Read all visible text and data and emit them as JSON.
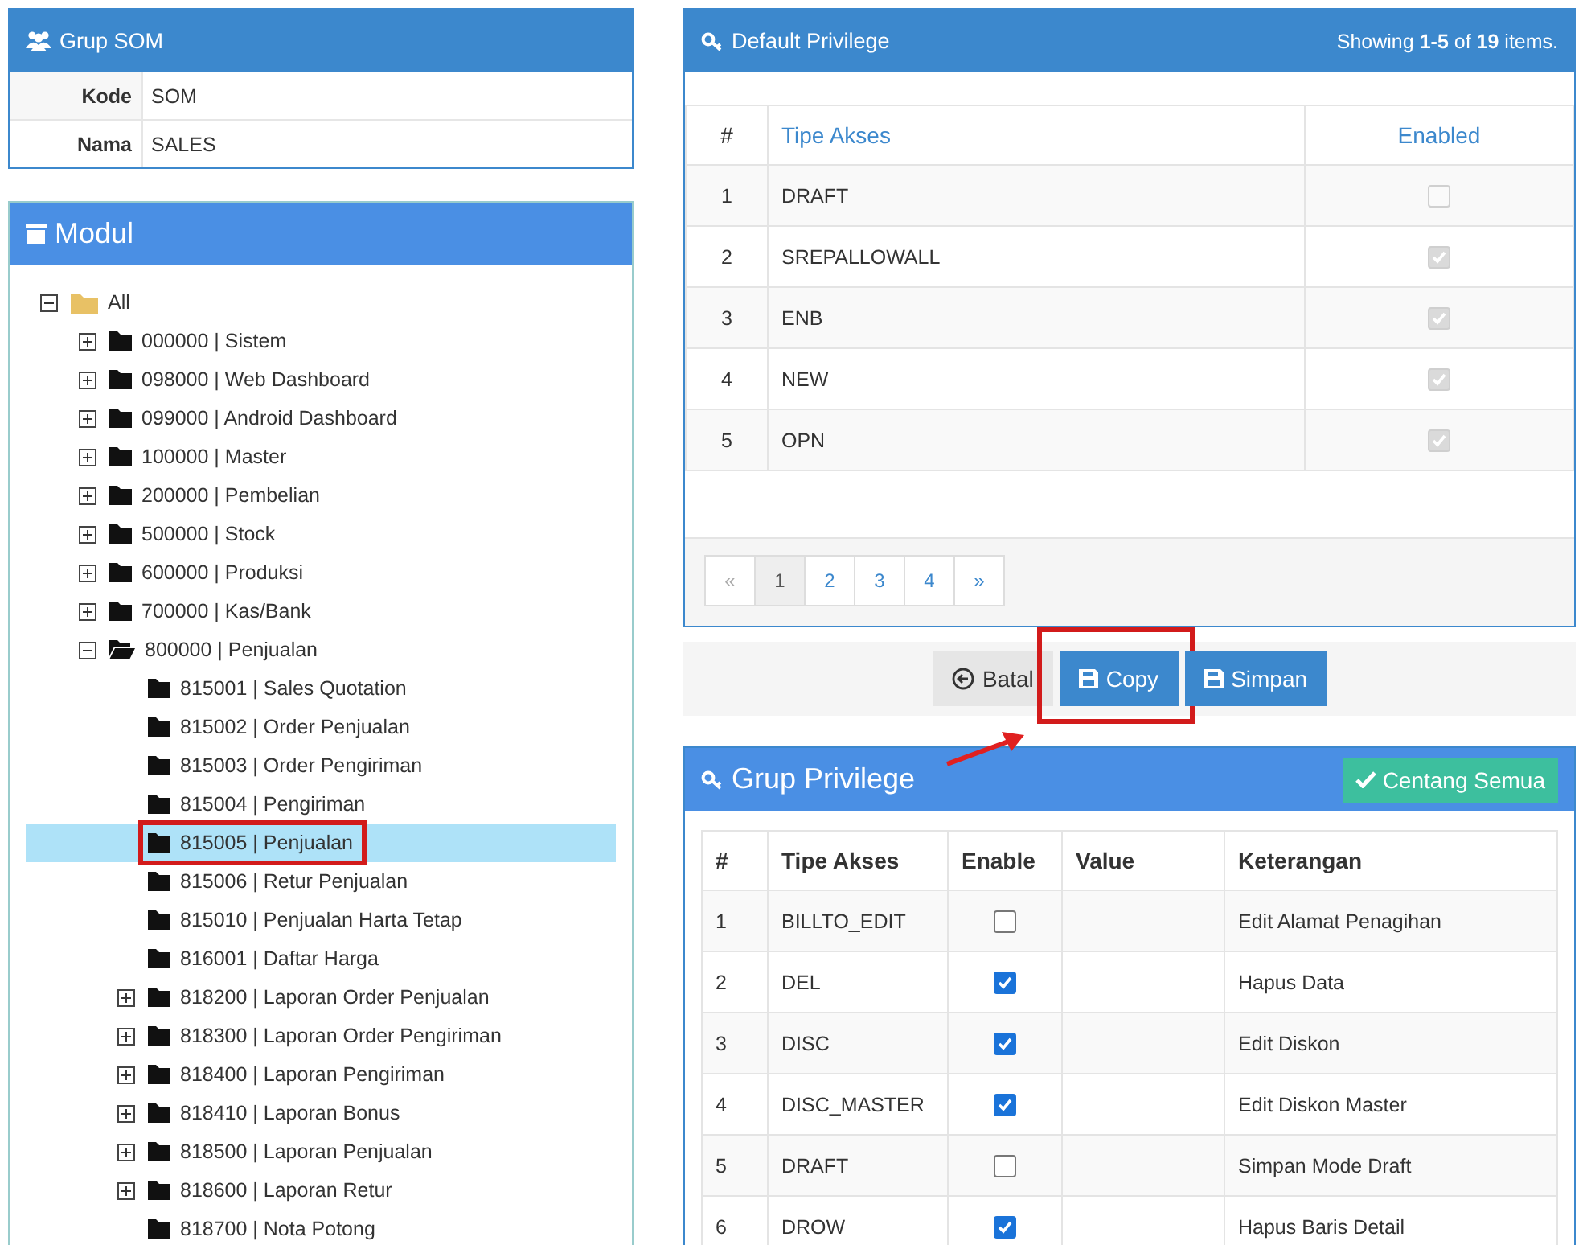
{
  "group_panel": {
    "title": "Grup SOM",
    "fields": [
      {
        "label": "Kode",
        "value": "SOM"
      },
      {
        "label": "Nama",
        "value": "SALES"
      }
    ]
  },
  "module_panel": {
    "title": "Modul",
    "tree": [
      {
        "label": "All",
        "expanded": true,
        "selected": false,
        "highlighted": false,
        "children": [
          {
            "label": "000000 | Sistem",
            "expanded": false,
            "selected": false,
            "highlighted": false
          },
          {
            "label": "098000 | Web Dashboard",
            "expanded": false,
            "selected": false,
            "highlighted": false
          },
          {
            "label": "099000 | Android Dashboard",
            "expanded": false,
            "selected": false,
            "highlighted": false
          },
          {
            "label": "100000 | Master",
            "expanded": false,
            "selected": false,
            "highlighted": false
          },
          {
            "label": "200000 | Pembelian",
            "expanded": false,
            "selected": false,
            "highlighted": false
          },
          {
            "label": "500000 | Stock",
            "expanded": false,
            "selected": false,
            "highlighted": false
          },
          {
            "label": "600000 | Produksi",
            "expanded": false,
            "selected": false,
            "highlighted": false
          },
          {
            "label": "700000 | Kas/Bank",
            "expanded": false,
            "selected": false,
            "highlighted": false
          },
          {
            "label": "800000 | Penjualan",
            "expanded": true,
            "selected": false,
            "highlighted": false,
            "children": [
              {
                "label": "815001 | Sales Quotation",
                "selected": false,
                "highlighted": false
              },
              {
                "label": "815002 | Order Penjualan",
                "selected": false,
                "highlighted": false
              },
              {
                "label": "815003 | Order Pengiriman",
                "selected": false,
                "highlighted": false
              },
              {
                "label": "815004 | Pengiriman",
                "selected": false,
                "highlighted": false
              },
              {
                "label": "815005 | Penjualan",
                "selected": true,
                "highlighted": true
              },
              {
                "label": "815006 | Retur Penjualan",
                "selected": false,
                "highlighted": false
              },
              {
                "label": "815010 | Penjualan Harta Tetap",
                "selected": false,
                "highlighted": false
              },
              {
                "label": "816001 | Daftar Harga",
                "selected": false,
                "highlighted": false
              },
              {
                "label": "818200 | Laporan Order Penjualan",
                "expanded": false,
                "selected": false,
                "highlighted": false
              },
              {
                "label": "818300 | Laporan Order Pengiriman",
                "expanded": false,
                "selected": false,
                "highlighted": false
              },
              {
                "label": "818400 | Laporan Pengiriman",
                "expanded": false,
                "selected": false,
                "highlighted": false
              },
              {
                "label": "818410 | Laporan Bonus",
                "expanded": false,
                "selected": false,
                "highlighted": false
              },
              {
                "label": "818500 | Laporan Penjualan",
                "expanded": false,
                "selected": false,
                "highlighted": false
              },
              {
                "label": "818600 | Laporan Retur",
                "expanded": false,
                "selected": false,
                "highlighted": false
              },
              {
                "label": "818700 | Nota Potong",
                "selected": false,
                "highlighted": false
              }
            ]
          }
        ]
      }
    ]
  },
  "default_privilege": {
    "title": "Default Privilege",
    "summary": "Showing **1-5** of **19** items.",
    "columns": [
      "#",
      "Tipe Akses",
      "Enabled"
    ],
    "rows": [
      {
        "no": "1",
        "type": "DRAFT",
        "checked": false,
        "disabled": true
      },
      {
        "no": "2",
        "type": "SREPALLOWALL",
        "checked": true,
        "disabled": true
      },
      {
        "no": "3",
        "type": "ENB",
        "checked": true,
        "disabled": true
      },
      {
        "no": "4",
        "type": "NEW",
        "checked": true,
        "disabled": true
      },
      {
        "no": "5",
        "type": "OPN",
        "checked": true,
        "disabled": true
      }
    ],
    "pagination": [
      {
        "label": "«",
        "selected": false,
        "disabled": true
      },
      {
        "label": "1",
        "selected": true,
        "disabled": false
      },
      {
        "label": "2",
        "selected": false,
        "disabled": false
      },
      {
        "label": "3",
        "selected": false,
        "disabled": false
      },
      {
        "label": "4",
        "selected": false,
        "disabled": false
      },
      {
        "label": "»",
        "selected": false,
        "disabled": false
      }
    ]
  },
  "actions": [
    {
      "label": "Batal",
      "kind": "back",
      "highlighted": false
    },
    {
      "label": "Copy",
      "kind": "save",
      "highlighted": true
    },
    {
      "label": "Simpan",
      "kind": "save",
      "highlighted": false
    }
  ],
  "group_privilege": {
    "title": "Grup Privilege",
    "check_all_button": "Centang Semua",
    "columns": [
      "#",
      "Tipe Akses",
      "Enable",
      "Value",
      "Keterangan"
    ],
    "rows": [
      {
        "no": "1",
        "type": "BILLTO_EDIT",
        "checked": false,
        "description": "Edit Alamat Penagihan"
      },
      {
        "no": "2",
        "type": "DEL",
        "checked": true,
        "description": "Hapus Data"
      },
      {
        "no": "3",
        "type": "DISC",
        "checked": true,
        "description": "Edit Diskon"
      },
      {
        "no": "4",
        "type": "DISC_MASTER",
        "checked": true,
        "description": "Edit Diskon Master"
      },
      {
        "no": "5",
        "type": "DRAFT",
        "checked": false,
        "description": "Simpan Mode Draft"
      },
      {
        "no": "6",
        "type": "DROW",
        "checked": true,
        "description": "Hapus Baris Detail"
      }
    ]
  }
}
